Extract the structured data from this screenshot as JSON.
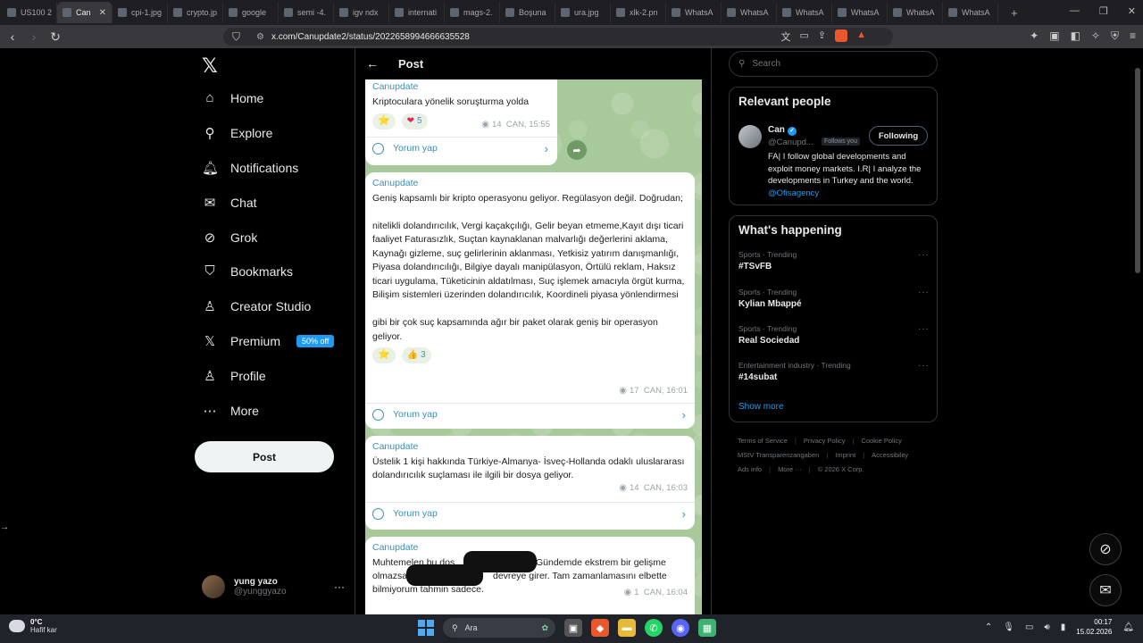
{
  "browser": {
    "tabs": [
      {
        "label": "US100 2",
        "active": false
      },
      {
        "label": "Can",
        "active": true
      },
      {
        "label": "cpi-1.jpg",
        "active": false
      },
      {
        "label": "crypto.jp",
        "active": false
      },
      {
        "label": "google",
        "active": false
      },
      {
        "label": "semi -4.",
        "active": false
      },
      {
        "label": "igv ndx",
        "active": false
      },
      {
        "label": "internati",
        "active": false
      },
      {
        "label": "mags-2.",
        "active": false
      },
      {
        "label": "Boşuna",
        "active": false
      },
      {
        "label": "ura.jpg",
        "active": false
      },
      {
        "label": "xlk-2.pn",
        "active": false
      },
      {
        "label": "WhatsA",
        "active": false
      },
      {
        "label": "WhatsA",
        "active": false
      },
      {
        "label": "WhatsA",
        "active": false
      },
      {
        "label": "WhatsA",
        "active": false
      },
      {
        "label": "WhatsA",
        "active": false
      },
      {
        "label": "WhatsA",
        "active": false
      }
    ],
    "url": "x.com/Canupdate2/status/2022658994666635528",
    "new_tab": "+"
  },
  "nav": {
    "logo": "𝕏",
    "items": [
      {
        "label": "Home",
        "icon": "home-icon",
        "glyph": "⌂"
      },
      {
        "label": "Explore",
        "icon": "search-icon",
        "glyph": "⚲"
      },
      {
        "label": "Notifications",
        "icon": "bell-icon",
        "glyph": "🔔︎"
      },
      {
        "label": "Chat",
        "icon": "mail-icon",
        "glyph": "✉"
      },
      {
        "label": "Grok",
        "icon": "grok-icon",
        "glyph": "⊘"
      },
      {
        "label": "Bookmarks",
        "icon": "bookmark-icon",
        "glyph": "⛉"
      },
      {
        "label": "Creator Studio",
        "icon": "creator-icon",
        "glyph": "♙"
      },
      {
        "label": "Premium",
        "icon": "x-premium-icon",
        "glyph": "𝕏",
        "badge": "50% off"
      },
      {
        "label": "Profile",
        "icon": "profile-icon",
        "glyph": "♙"
      },
      {
        "label": "More",
        "icon": "more-icon",
        "glyph": "⋯"
      }
    ],
    "post_button": "Post",
    "user": {
      "name": "yung yazo",
      "handle": "@yunggyazo",
      "menu": "···"
    }
  },
  "post": {
    "header_title": "Post",
    "messages": [
      {
        "sender": "Canupdate",
        "text": "Kriptoculara yönelik soruşturma yolda",
        "reactions": [
          {
            "emoji": "⭐",
            "count": ""
          },
          {
            "emoji": "❤",
            "count": "5"
          }
        ],
        "views": "14",
        "author_time": "CAN, 15:55",
        "comment_label": "Yorum yap"
      },
      {
        "sender": "Canupdate",
        "text": "Geniş kapsamlı bir kripto operasyonu geliyor. Regülasyon değil. Doğrudan;\n\n nitelikli dolandırıcılık, Vergi kaçakçılığı, Gelir beyan etmeme,Kayıt dışı ticari faaliyet Faturasızlık, Suçtan kaynaklanan malvarlığı değerlerini aklama, Kaynağı gizleme, suç gelirlerinin aklanması, Yetkisiz yatırım danışmanlığı, Piyasa dolandırıcılığı, Bilgiye dayalı manipülasyon, Örtülü reklam, Haksız ticari uygulama, Tüketicinin aldatılması, Suç işlemek amacıyla örgüt kurma, Bilişim sistemleri üzerinden dolandırıcılık, Koordineli piyasa yönlendirmesi\n\ngibi bir çok suç kapsamında ağır bir paket olarak geniş bir operasyon geliyor.",
        "reactions": [
          {
            "emoji": "⭐",
            "count": ""
          },
          {
            "emoji": "👍",
            "count": "3"
          }
        ],
        "views": "17",
        "author_time": "CAN, 16:01",
        "comment_label": "Yorum yap"
      },
      {
        "sender": "Canupdate",
        "text": "Üstelik 1 kişi hakkında Türkiye-Almanya- İsveç-Hollanda odaklı uluslararası dolandırıcılık suçlaması ile ilgili bir dosya geliyor.",
        "reactions": [],
        "views": "14",
        "author_time": "CAN, 16:03",
        "comment_label": "Yorum yap"
      },
      {
        "sender": "Canupdate",
        "text_line1a": "Muhtemelen bu dos",
        "text_line1b": "Gündemde ekstrem bir gelişme",
        "text_line2a": "olmazsa",
        "text_line2b": "devreye girer. Tam zamanlamasını elbette",
        "text_line3": "bilmiyorum tahmin sadece.",
        "views": "1",
        "author_time": "CAN, 16:04"
      }
    ]
  },
  "sidebar": {
    "search_placeholder": "Search",
    "relevant": {
      "title": "Relevant people",
      "name": "Can",
      "handle": "@Canupd...",
      "follows_you": "Follows you",
      "follow_button": "Following",
      "bio": "FA| I follow global developments and exploit money markets. I.R| I analyze the developments in Turkey and the world.",
      "bio_mention": "@Ofisagency"
    },
    "happening": {
      "title": "What's happening",
      "trends": [
        {
          "category": "Sports · Trending",
          "topic": "#TSvFB"
        },
        {
          "category": "Sports · Trending",
          "topic": "Kylian Mbappé"
        },
        {
          "category": "Sports · Trending",
          "topic": "Real Sociedad"
        },
        {
          "category": "Entertainment industry · Trending",
          "topic": "#14subat"
        }
      ],
      "show_more": "Show more"
    },
    "footer": [
      "Terms of Service",
      "Privacy Policy",
      "Cookie Policy",
      "MStV Transparenzangaben",
      "Imprint",
      "Accessibility",
      "Ads info",
      "More ···",
      "© 2026 X Corp."
    ]
  },
  "taskbar": {
    "temp": "0°C",
    "weather": "Hafif kar",
    "search": "Ara",
    "time": "00:17",
    "date": "15.02.2026"
  },
  "colors": {
    "accent": "#1d9bf0",
    "chat_bg": "#a8c99a",
    "sender": "#3a8fb7"
  }
}
